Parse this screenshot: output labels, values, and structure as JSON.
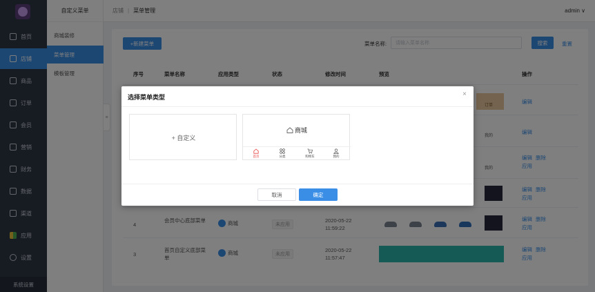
{
  "nav": {
    "items": [
      {
        "label": "首页",
        "icon": "home-icon"
      },
      {
        "label": "店铺",
        "icon": "shop-icon"
      },
      {
        "label": "商品",
        "icon": "goods-icon"
      },
      {
        "label": "订单",
        "icon": "order-icon"
      },
      {
        "label": "会员",
        "icon": "user-icon"
      },
      {
        "label": "营销",
        "icon": "marketing-icon"
      },
      {
        "label": "财务",
        "icon": "finance-icon"
      },
      {
        "label": "数据",
        "icon": "data-icon"
      },
      {
        "label": "渠道",
        "icon": "channel-icon"
      },
      {
        "label": "应用",
        "icon": "apps-icon"
      },
      {
        "label": "设置",
        "icon": "settings-icon"
      }
    ],
    "footer": "系统设置"
  },
  "subnav": {
    "title": "自定义菜单",
    "items": [
      "商城装修",
      "菜单管理",
      "模板管理"
    ]
  },
  "header": {
    "crumb_parent": "店铺",
    "crumb_current": "菜单管理",
    "user": "admin ∨"
  },
  "toolbar": {
    "new_button": "+新建菜单",
    "search_label": "菜单名称:",
    "search_placeholder": "请输入菜单名称",
    "search_button": "搜索",
    "reset_button": "重置"
  },
  "table": {
    "headers": [
      "序号",
      "菜单名称",
      "应用类型",
      "状态",
      "修改时间",
      "预览",
      "操作"
    ],
    "rows": [
      {
        "no": "4",
        "name": "会员中心底部菜单",
        "app": "商城",
        "status": "未应用",
        "date": "2020-05-22",
        "time": "11:59:22",
        "actions": [
          "编辑",
          "删除",
          "应用"
        ]
      },
      {
        "no": "3",
        "name": "首页自定义底部菜单",
        "app": "商城",
        "status": "未应用",
        "date": "2020-05-22",
        "time": "11:57:47",
        "actions": [
          "编辑",
          "删除",
          "应用"
        ]
      }
    ],
    "partial_actions": {
      "row1": [
        "编辑"
      ],
      "row2": [
        "编辑"
      ],
      "row3": [
        "编辑",
        "删除",
        "应用"
      ],
      "row4": [
        "编辑",
        "删除",
        "应用"
      ]
    },
    "preview_labels": {
      "order": "订单",
      "mine": "我的"
    }
  },
  "modal": {
    "title": "选择菜单类型",
    "close": "×",
    "custom_card_label": "+ 自定义",
    "shop_card_title": "商城",
    "shop_tabs": [
      "首页",
      "分类",
      "购物车",
      "我的"
    ],
    "cancel_button": "取消",
    "ok_button": "确定"
  },
  "colors": {
    "accent": "#3a8ee6",
    "nav_bg": "#2f3645",
    "tab_active": "#e64340"
  }
}
